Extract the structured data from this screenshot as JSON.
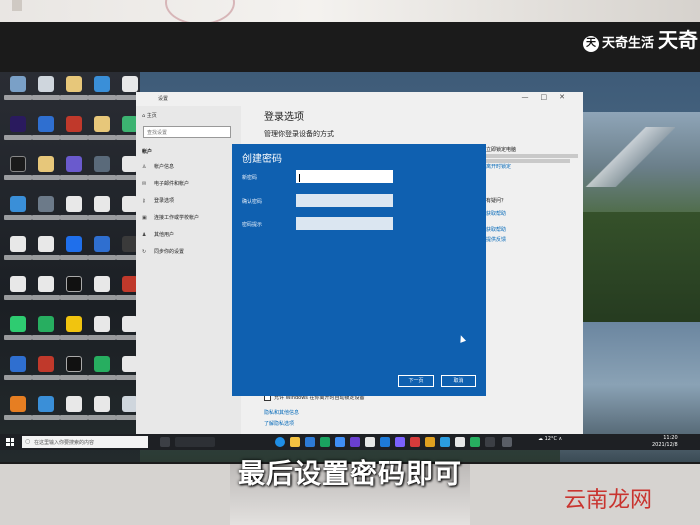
{
  "settings_window": {
    "title": "设置",
    "controls": "—□✕",
    "home": "⌂  主页",
    "search_placeholder": "查找设置",
    "section": "帐户",
    "nav": [
      {
        "icon": "user-icon",
        "glyph": "♙",
        "label": "帐户信息"
      },
      {
        "icon": "mail-icon",
        "glyph": "✉",
        "label": "电子邮件和帐户"
      },
      {
        "icon": "key-icon",
        "glyph": "⚷",
        "label": "登录选项"
      },
      {
        "icon": "briefcase-icon",
        "glyph": "▣",
        "label": "连接工作或学校帐户"
      },
      {
        "icon": "family-icon",
        "glyph": "♟",
        "label": "其他用户"
      },
      {
        "icon": "sync-icon",
        "glyph": "↻",
        "label": "同步你的设置"
      }
    ],
    "main_title": "登录选项",
    "main_subtitle": "管理你登录设备的方式",
    "right": {
      "heading": "立即锁定电脑",
      "link": "离开时锁定",
      "heading2": "有疑问？",
      "link2": "获取帮助",
      "help_items": [
        "获取帮助",
        "提供反馈"
      ]
    },
    "checkbox_label": "允许 Windows 在你离开时自动锁定设备",
    "links": [
      "隐私和其他信息",
      "了解隐私选项"
    ]
  },
  "dialog": {
    "title": "创建密码",
    "fields": [
      {
        "label": "新密码",
        "value": ""
      },
      {
        "label": "确认密码",
        "value": ""
      },
      {
        "label": "密码提示",
        "value": ""
      }
    ],
    "next_button": "下一页",
    "cancel_button": "取消"
  },
  "taskbar": {
    "search_placeholder": "在这里输入你要搜索的内容",
    "tray": "☁ 12°C  ∧",
    "time": "11:20",
    "date": "2021/12/8"
  },
  "overlay": {
    "subtitle": "最后设置密码即可",
    "watermark_top": "天奇生活",
    "watermark_logo": "天",
    "watermark_corner": "天奇",
    "watermark_bottom": "云南龙网"
  },
  "colors": {
    "dialog_bg": "#0f60b0",
    "link": "#0067b8",
    "watermark_red": "#c9342f"
  }
}
